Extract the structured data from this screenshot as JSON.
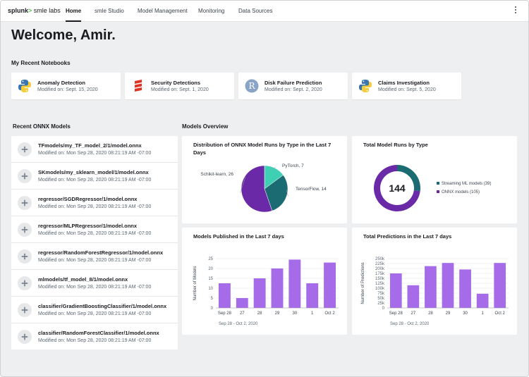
{
  "brand": {
    "splunk": "splunk",
    "gt": ">",
    "smle": " smle labs"
  },
  "nav": [
    {
      "label": "Home",
      "active": true
    },
    {
      "label": "smle Studio"
    },
    {
      "label": "Model Management"
    },
    {
      "label": "Monitoring"
    },
    {
      "label": "Data Sources"
    }
  ],
  "welcome": "Welcome, Amir.",
  "recent_notebooks": {
    "title": "My Recent Notebooks",
    "items": [
      {
        "name": "Anomaly Detection",
        "modified": "Modified on: Sept. 15, 2020",
        "icon": "python-icon"
      },
      {
        "name": "Security Detections",
        "modified": "Modified on: Sept. 1, 2020",
        "icon": "scala-icon"
      },
      {
        "name": "Disk Failure Prediction",
        "modified": "Modified on: Sept. 2, 2020",
        "icon": "r-icon"
      },
      {
        "name": "Claims Investigation",
        "modified": "Modified on: Sept. 5, 2020",
        "icon": "python-icon"
      }
    ]
  },
  "onnx": {
    "title": "Recent ONNX Models",
    "items": [
      {
        "path": "TFmodels/my_TF_model_2/1/model.onnx",
        "modified": "Modified on:  Mon Sep 28, 2020    08:21:19 AM -07:00"
      },
      {
        "path": "SKmodels/my_sklearn_model/1/model.onnx",
        "modified": "Modified on:  Mon Sep 28, 2020    08:21:19 AM -07:00"
      },
      {
        "path": "regressor/SGDRegressor/1/model.onnx",
        "modified": "Modified on:  Mon Sep 28, 2020    08:21:19 AM -07:00"
      },
      {
        "path": "regressor/MLPRegressor/1/model.onnx",
        "modified": "Modified on:  Mon Sep 28, 2020    08:21:19 AM -07:00"
      },
      {
        "path": "regressor/RandomForestRegressor/1/model.onnx",
        "modified": "Modified on:  Mon Sep 28, 2020    08:21:19 AM -07:00"
      },
      {
        "path": "mlmodels/tf_model_8/1/model.onnx",
        "modified": "Modified on:  Mon Sep 28, 2020    08:21:19 AM -07:00"
      },
      {
        "path": "classifier/GradientBoostingClassifier/1/model.onnx",
        "modified": "Modified on:  Mon Sep 28, 2020    08:21:19 AM -07:00"
      },
      {
        "path": "classifier/RandomForestClassifier/1/model.onnx",
        "modified": "Modified on:  Mon Sep 28, 2020    08:21:19 AM -07:00"
      }
    ]
  },
  "overview": {
    "title": "Models Overview"
  },
  "colors": {
    "purple": "#7b2fbf",
    "teal": "#1a6b72",
    "mint": "#3fcfb4",
    "bar": "#a66be8",
    "navy": "#1a1c20"
  },
  "chart_data": [
    {
      "type": "pie",
      "title": "Distribution of ONNX Model Runs by Type in the Last 7 Days",
      "slices": [
        {
          "label": "PyTorch, 7",
          "value": 7,
          "color": "#3fcfb4"
        },
        {
          "label": "TensorFlow, 14",
          "value": 14,
          "color": "#1a6b72"
        },
        {
          "label": "Schikit-learn, 26",
          "value": 26,
          "color": "#6a2aa8"
        }
      ]
    },
    {
      "type": "pie",
      "title": "Total Model Runs by Type",
      "center_label": "144",
      "slices": [
        {
          "label": "Streaming ML models (39)",
          "value": 39,
          "color": "#1a6b72"
        },
        {
          "label": "ONNX models (105)",
          "value": 105,
          "color": "#6a2aa8"
        }
      ],
      "legend": "right"
    },
    {
      "type": "bar",
      "title": "Models Published in the Last 7 days",
      "categories": [
        "Sep 28",
        "27",
        "28",
        "29",
        "30",
        "1",
        "Oct 2"
      ],
      "values": [
        12.5,
        5,
        15,
        20,
        24.5,
        12.5,
        23
      ],
      "ylabel": "Number of Models",
      "ylim": [
        0,
        25
      ],
      "yticks": [
        "0",
        "5",
        "10",
        "15",
        "20",
        "25"
      ],
      "yticks_values": [
        0,
        5,
        10,
        15,
        20,
        25
      ],
      "subtitle": "Sep 28 - Oct 2, 2020",
      "grid": true
    },
    {
      "type": "bar",
      "title": "Total Predictions in the Last 7 days",
      "categories": [
        "Sep 28",
        "27",
        "28",
        "29",
        "30",
        "1",
        "Oct 2"
      ],
      "values": [
        175000,
        115000,
        212000,
        228000,
        195000,
        72000,
        228000
      ],
      "ylabel": "Number of Predictions",
      "ylim": [
        0,
        250000
      ],
      "yticks": [
        "0",
        "25k",
        "50k",
        "75k",
        "100k",
        "125k",
        "150k",
        "175k",
        "200k",
        "225k",
        "250k"
      ],
      "yticks_values": [
        0,
        25000,
        50000,
        75000,
        100000,
        125000,
        150000,
        175000,
        200000,
        225000,
        250000
      ],
      "subtitle": "Sep 28 - Oct 2, 2020",
      "grid": true
    }
  ]
}
